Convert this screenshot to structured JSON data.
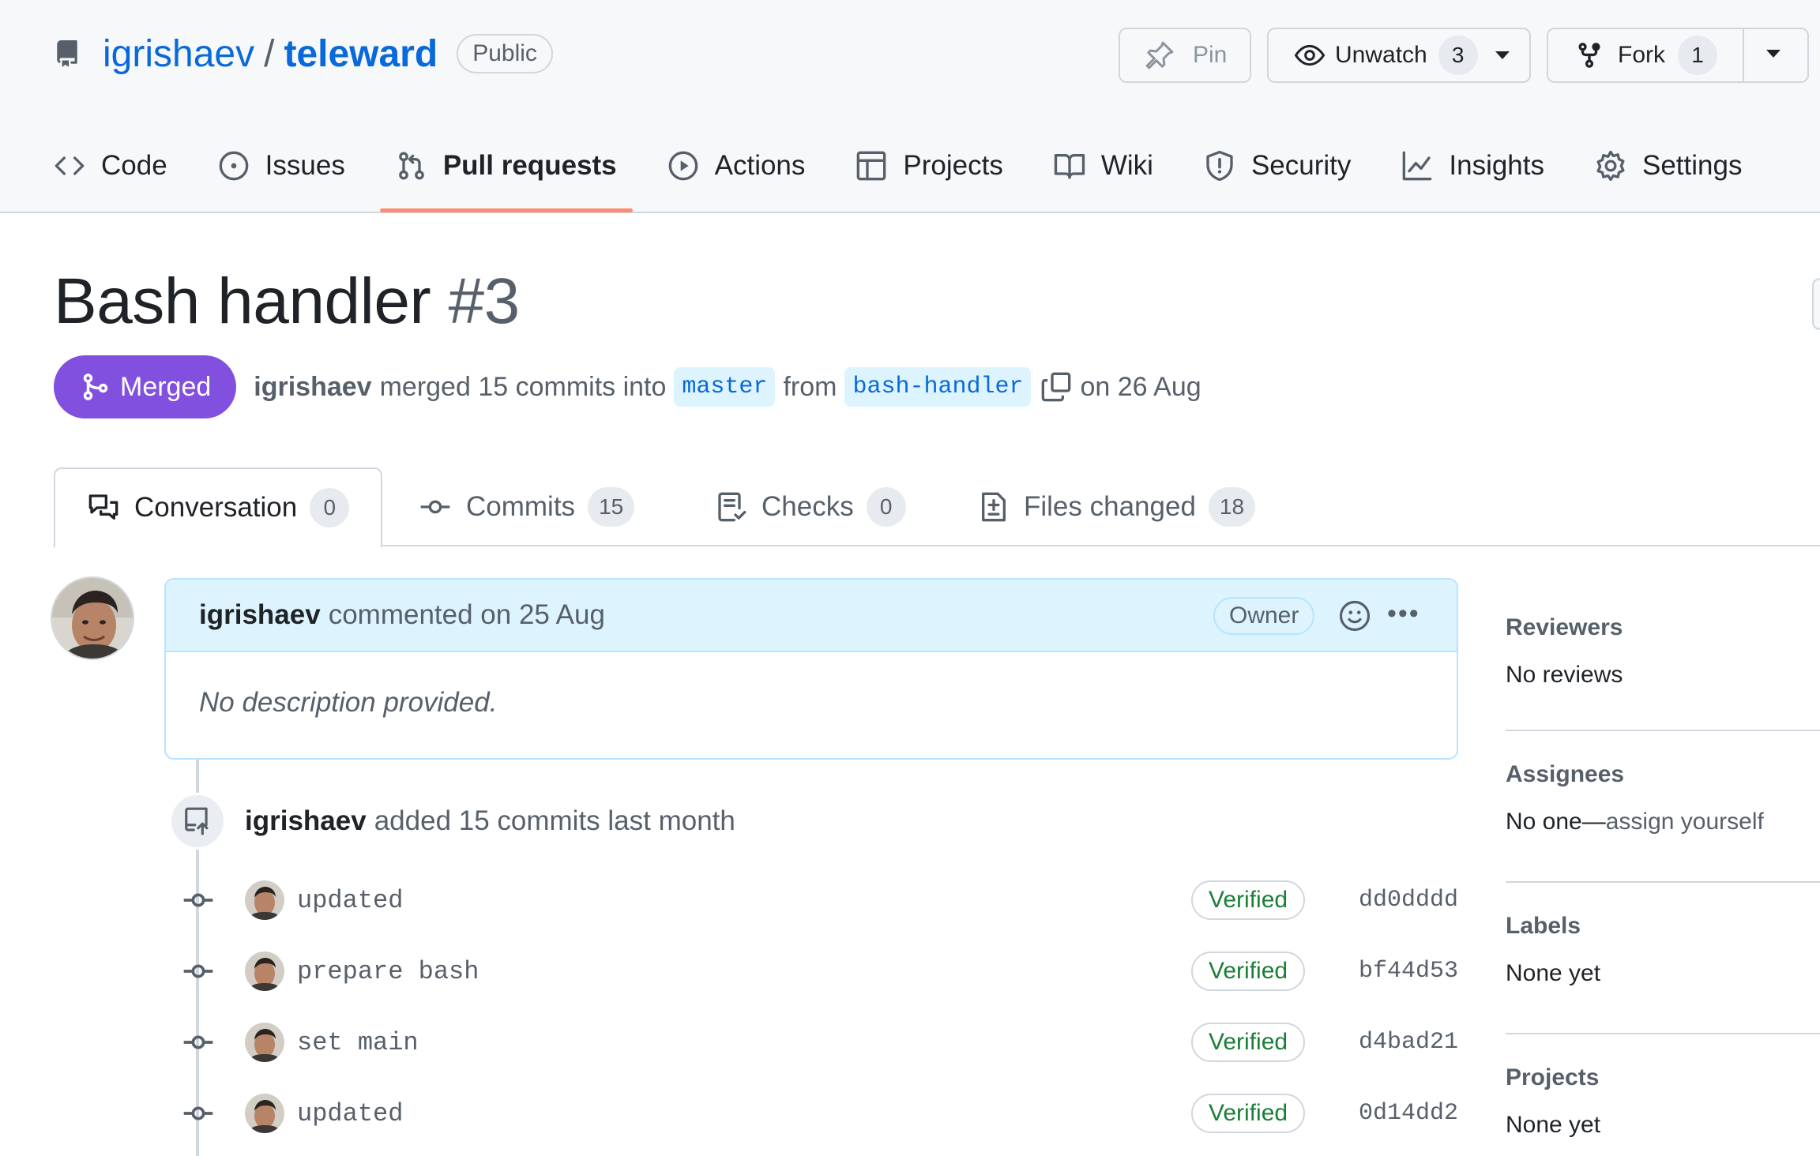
{
  "repo": {
    "owner": "igrishaev",
    "separator": "/",
    "name": "teleward",
    "visibility": "Public"
  },
  "actions": {
    "pin_label": "Pin",
    "watch_label": "Unwatch",
    "watch_count": "3",
    "fork_label": "Fork",
    "fork_count": "1"
  },
  "nav": {
    "items": [
      {
        "label": "Code",
        "icon": "code-icon"
      },
      {
        "label": "Issues",
        "icon": "issue-opened-icon"
      },
      {
        "label": "Pull requests",
        "icon": "git-pull-request-icon",
        "selected": true
      },
      {
        "label": "Actions",
        "icon": "play-icon"
      },
      {
        "label": "Projects",
        "icon": "table-icon"
      },
      {
        "label": "Wiki",
        "icon": "book-icon"
      },
      {
        "label": "Security",
        "icon": "shield-icon"
      },
      {
        "label": "Insights",
        "icon": "graph-icon"
      },
      {
        "label": "Settings",
        "icon": "gear-icon"
      }
    ]
  },
  "pr": {
    "title": "Bash handler",
    "number": "#3",
    "state": "Merged",
    "author": "igrishaev",
    "merged_text": "merged 15 commits into",
    "base_branch": "master",
    "from_text": "from",
    "head_branch": "bash-handler",
    "date_text": "on 26 Aug"
  },
  "tabs": [
    {
      "label": "Conversation",
      "count": "0",
      "icon": "comment-discussion-icon",
      "selected": true
    },
    {
      "label": "Commits",
      "count": "15",
      "icon": "git-commit-icon"
    },
    {
      "label": "Checks",
      "count": "0",
      "icon": "checklist-icon"
    },
    {
      "label": "Files changed",
      "count": "18",
      "icon": "file-diff-icon"
    }
  ],
  "comment": {
    "author": "igrishaev",
    "meta": "commented on 25 Aug",
    "role": "Owner",
    "body": "No description provided."
  },
  "event": {
    "author": "igrishaev",
    "text": "added 15 commits last month"
  },
  "commits": [
    {
      "message": "updated",
      "verified": "Verified",
      "sha": "dd0dddd"
    },
    {
      "message": "prepare bash",
      "verified": "Verified",
      "sha": "bf44d53"
    },
    {
      "message": "set main",
      "verified": "Verified",
      "sha": "d4bad21"
    },
    {
      "message": "updated",
      "verified": "Verified",
      "sha": "0d14dd2"
    }
  ],
  "sidebar": {
    "reviewers": {
      "title": "Reviewers",
      "value": "No reviews"
    },
    "assignees": {
      "title": "Assignees",
      "value": "No one",
      "dash": "—",
      "link": "assign yourself"
    },
    "labels": {
      "title": "Labels",
      "value": "None yet"
    },
    "projects": {
      "title": "Projects",
      "value": "None yet"
    }
  },
  "colors": {
    "merged": "#8250df",
    "link": "#0969da",
    "verified": "#1a7f37",
    "tab_underline": "#fd8c73"
  }
}
